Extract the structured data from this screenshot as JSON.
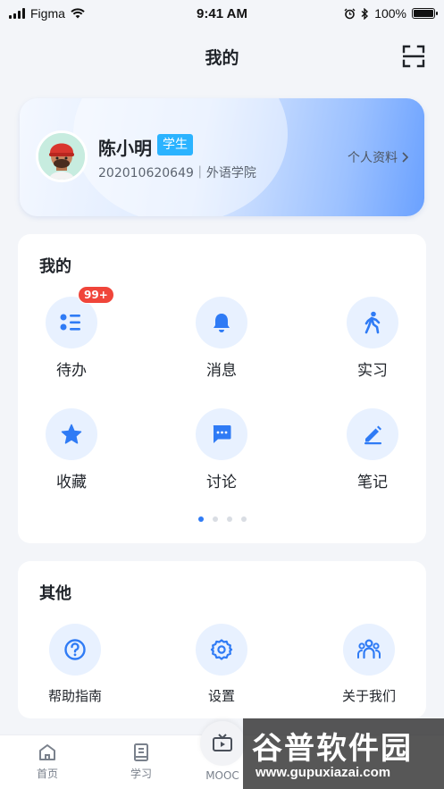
{
  "status_bar": {
    "carrier": "Figma",
    "time": "9:41 AM",
    "battery": "100%"
  },
  "nav": {
    "title": "我的",
    "scan_icon": "scan-icon"
  },
  "profile": {
    "name": "陈小明",
    "role_badge": "学生",
    "subtitle": "202010620649｜外语学院",
    "link_label": "个人资料"
  },
  "mine": {
    "title": "我的",
    "items": [
      {
        "label": "待办",
        "icon": "todo-list-icon",
        "badge": "99+"
      },
      {
        "label": "消息",
        "icon": "bell-icon"
      },
      {
        "label": "实习",
        "icon": "walking-person-icon"
      },
      {
        "label": "收藏",
        "icon": "star-icon"
      },
      {
        "label": "讨论",
        "icon": "chat-bubble-icon"
      },
      {
        "label": "笔记",
        "icon": "pencil-icon"
      }
    ],
    "page_count": 4,
    "active_page": 1
  },
  "other": {
    "title": "其他",
    "items": [
      {
        "label": "帮助指南",
        "icon": "help-question-icon"
      },
      {
        "label": "设置",
        "icon": "gear-icon"
      },
      {
        "label": "关于我们",
        "icon": "team-icon"
      }
    ]
  },
  "tabbar": {
    "items": [
      {
        "label": "首页",
        "icon": "home-icon"
      },
      {
        "label": "学习",
        "icon": "book-icon"
      },
      {
        "label": "MOOC",
        "icon": "tv-icon"
      }
    ]
  },
  "watermark": {
    "title": "谷普软件园",
    "url": "www.gupuxiazai.com"
  },
  "colors": {
    "accent": "#2f7bf5",
    "badge_red": "#f0453a",
    "icon_bg": "#e8f1ff",
    "role_badge": "#2bb3ff"
  }
}
